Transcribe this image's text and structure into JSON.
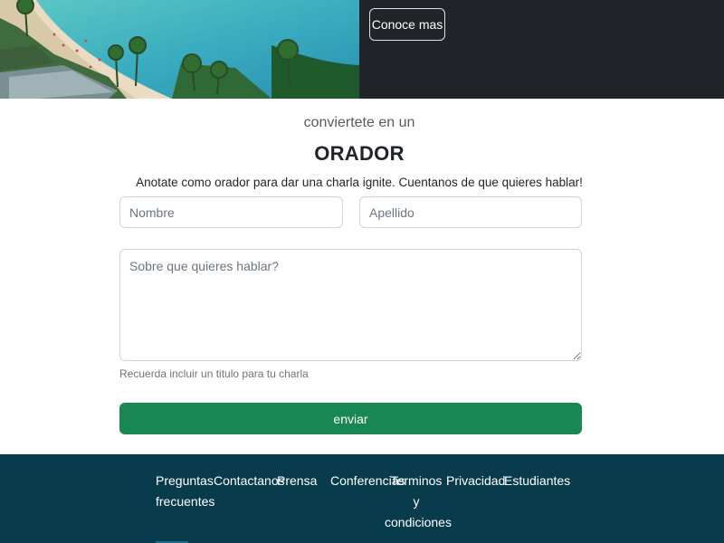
{
  "hero": {
    "button_label": "Conoce mas"
  },
  "section": {
    "subtitle": "conviertete en un",
    "title": "ORADOR",
    "lead": "Anotate como orador para dar una charla ignite. Cuentanos de que quieres hablar!"
  },
  "form": {
    "nombre_placeholder": "Nombre",
    "apellido_placeholder": "Apellido",
    "tema_placeholder": "Sobre que quieres hablar?",
    "hint": "Recuerda incluir un titulo para tu charla",
    "submit_label": "enviar"
  },
  "footer": {
    "links": [
      {
        "label_line1": "Preguntas",
        "label_line2": "frecuentes"
      },
      {
        "label": "Contactanos"
      },
      {
        "label": "Prensa"
      },
      {
        "label": "Conferencias"
      },
      {
        "label_line1": "Terminos",
        "label_line2": "y",
        "label_line3": "condiciones"
      },
      {
        "label": "Privacidad"
      },
      {
        "label": "Estudiantes"
      }
    ]
  },
  "colors": {
    "dark_panel": "#212529",
    "submit_green": "#198754",
    "footer_bg": "#083c4c"
  }
}
